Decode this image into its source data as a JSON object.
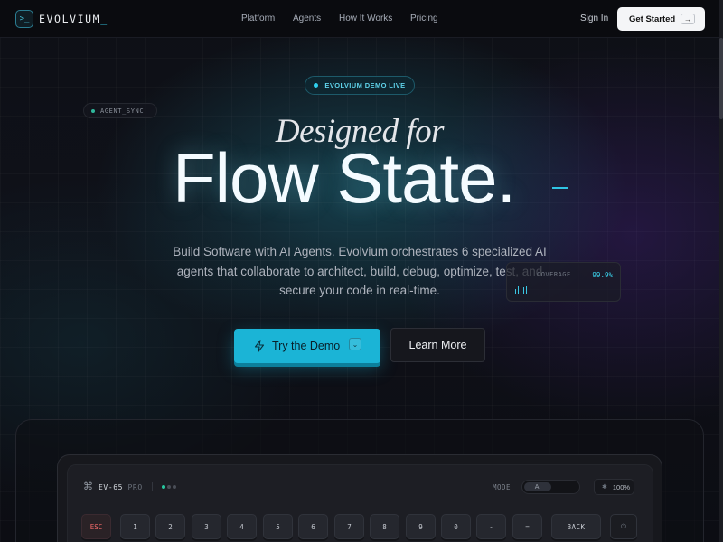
{
  "nav": {
    "logo_glyph": ">_",
    "logo_text": "EVOLVIUM",
    "logo_cursor": "_",
    "links": [
      "Platform",
      "Agents",
      "How It Works",
      "Pricing"
    ],
    "sign_in": "Sign In",
    "get_started": "Get Started",
    "get_started_arrow": "→"
  },
  "hero": {
    "badge": "EVOLVIUM DEMO LIVE",
    "agent_sync": "AGENT_SYNC",
    "designed": "Designed for",
    "flow": "Flow State.",
    "subtitle": "Build Software with AI Agents. Evolvium orchestrates 6 specialized AI agents that collaborate to architect, build, debug, optimize, test, and secure your code in real-time.",
    "coverage_label": "COVERAGE",
    "coverage_value": "99.9%",
    "try_demo": "Try the Demo",
    "try_demo_key": "⌄",
    "learn_more": "Learn More"
  },
  "device": {
    "title": "EV-65",
    "title_suffix": "PRO",
    "mode_label": "MODE",
    "mode_value": "AI",
    "battery": "100%",
    "power_glyph": "⏻",
    "keys": [
      "ESC",
      "1",
      "2",
      "3",
      "4",
      "5",
      "6",
      "7",
      "8",
      "9",
      "0",
      "-",
      "=",
      "BACK"
    ]
  },
  "colors": {
    "accent": "#1bb4d6",
    "background": "#0b0c12",
    "status_green": "#27c79f"
  }
}
